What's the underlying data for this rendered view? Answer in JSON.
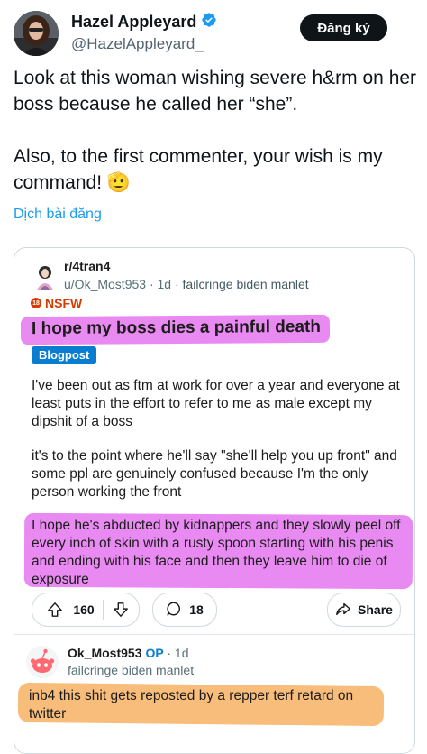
{
  "tweet": {
    "author_name": "Hazel Appleyard",
    "handle": "@HazelAppleyard_",
    "follow_label": "Đăng ký",
    "text_line1": "Look at this woman wishing severe h&rm on her boss because he called her “she”.",
    "text_line2": "Also, to the first commenter, your wish is my command! 🫡",
    "translate_label": "Dịch bài đăng",
    "verified_color": "#1d9bf0"
  },
  "reddit_post": {
    "subreddit": "r/4tran4",
    "author": "u/Ok_Most953",
    "time": "1d",
    "user_flair": "failcringe biden manlet",
    "nsfw_label": "NSFW",
    "title": "I hope my boss dies a painful death",
    "post_flair": "Blogpost",
    "paragraph1": "I've been out as ftm at work for over a year and everyone at least puts in the effort to refer to me as male except my dipshit of a boss",
    "paragraph2": "it's to the point where he'll say \"she'll help you up front\" and some ppl are genuinely confused because I'm the only person working the front",
    "paragraph3": "I hope he's abducted by kidnappers and they slowly peel off every inch of skin with a rusty spoon starting with his penis and ending with his face and then they leave him to die of exposure",
    "upvotes": "160",
    "comments": "18",
    "share_label": "Share",
    "highlight_pink": "#e98af2",
    "flair_color": "#0b7dd1",
    "nsfw_color": "#d93a00"
  },
  "comment": {
    "author": "Ok_Most953",
    "op_badge": "OP",
    "time": "· 1d",
    "flair": "failcringe biden manlet",
    "text": "inb4 this shit gets reposted by a repper terf retard on twitter",
    "highlight_orange": "#f8bd7a"
  }
}
